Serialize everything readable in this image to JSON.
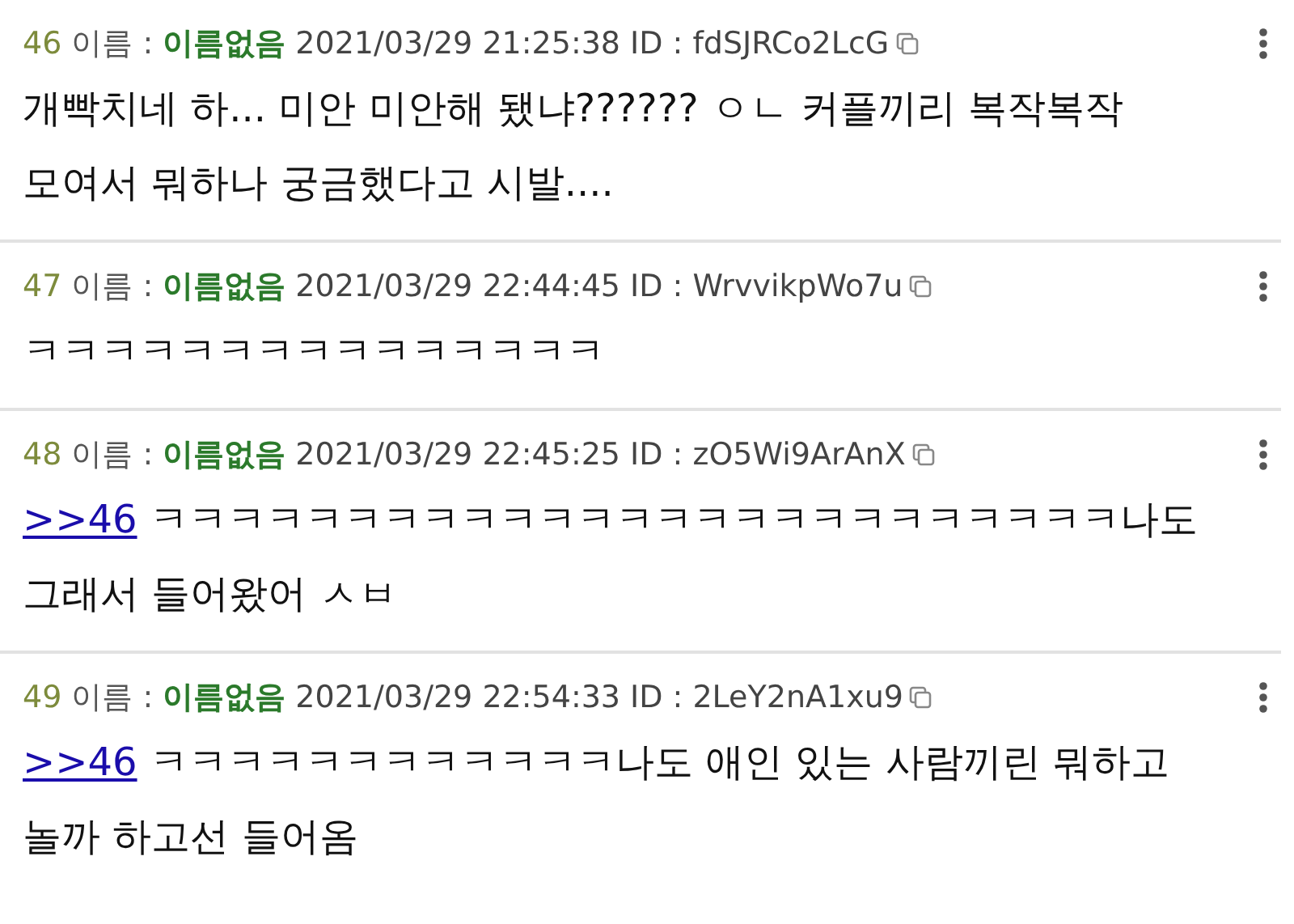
{
  "posts": [
    {
      "number": "46",
      "name_label": "이름 :",
      "name": "이름없음",
      "datetime": "2021/03/29 21:25:38",
      "id_label": "ID :",
      "id": "fdSJRCo2LcG",
      "body": "개빡치네 하... 미안 미안해 됐냐?????? ㅇㄴ 커플끼리 복작복작 모여서 뭐하나 궁금했다고 시발...."
    },
    {
      "number": "47",
      "name_label": "이름 :",
      "name": "이름없음",
      "datetime": "2021/03/29 22:44:45",
      "id_label": "ID :",
      "id": "WrvvikpWo7u",
      "body": "ㅋㅋㅋㅋㅋㅋㅋㅋㅋㅋㅋㅋㅋㅋㅋ"
    },
    {
      "number": "48",
      "name_label": "이름 :",
      "name": "이름없음",
      "datetime": "2021/03/29 22:45:25",
      "id_label": "ID :",
      "id": "zO5Wi9ArAnX",
      "reply_link": ">>46",
      "body": "ㅋㅋㅋㅋㅋㅋㅋㅋㅋㅋㅋㅋㅋㅋㅋㅋㅋㅋㅋㅋㅋㅋㅋㅋㅋ나도 그래서 들어왔어 ㅅㅂ"
    },
    {
      "number": "49",
      "name_label": "이름 :",
      "name": "이름없음",
      "datetime": "2021/03/29 22:54:33",
      "id_label": "ID :",
      "id": "2LeY2nA1xu9",
      "reply_link": ">>46",
      "body": "ㅋㅋㅋㅋㅋㅋㅋㅋㅋㅋㅋㅋ나도 애인 있는 사람끼린 뭐하고 놀까 하고선 들어옴"
    }
  ]
}
